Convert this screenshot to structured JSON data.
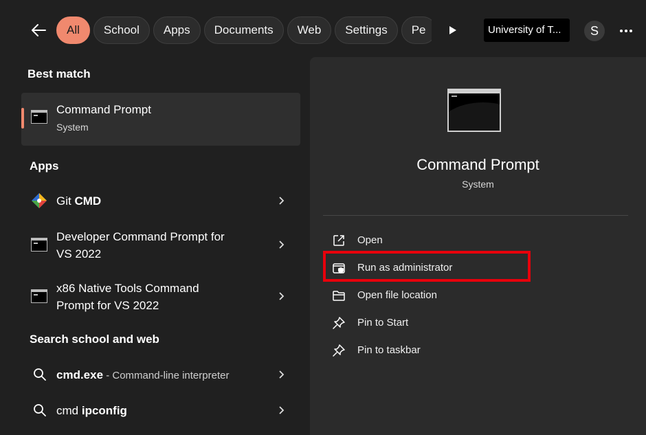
{
  "header": {
    "chips": [
      {
        "label": "All",
        "active": true
      },
      {
        "label": "School"
      },
      {
        "label": "Apps"
      },
      {
        "label": "Documents"
      },
      {
        "label": "Web"
      },
      {
        "label": "Settings"
      },
      {
        "label": "Pe"
      }
    ],
    "org_badge": "University of T...",
    "avatar_initial": "S"
  },
  "left": {
    "best_match_heading": "Best match",
    "best_match": {
      "title": "Command Prompt",
      "subtitle": "System"
    },
    "apps_heading": "Apps",
    "apps": [
      {
        "label": "Git ",
        "label_bold": "CMD",
        "icon": "git-icon"
      },
      {
        "line1": "Developer Command Prompt for",
        "line2": "VS 2022",
        "icon": "command-prompt-icon"
      },
      {
        "line1": "x86 Native Tools Command",
        "line2": "Prompt for VS 2022",
        "icon": "command-prompt-icon"
      }
    ],
    "search_heading": "Search school and web",
    "searches": [
      {
        "bold": "cmd.exe",
        "rest": " - Command-line interpreter",
        "icon": "search-icon"
      },
      {
        "plain": "cmd ",
        "bold": "ipconfig",
        "icon": "search-icon"
      }
    ]
  },
  "detail": {
    "title": "Command Prompt",
    "subtitle": "System",
    "actions": [
      {
        "label": "Open",
        "icon": "open-external-icon"
      },
      {
        "label": "Run as administrator",
        "icon": "shield-icon"
      },
      {
        "label": "Open file location",
        "icon": "folder-icon"
      },
      {
        "label": "Pin to Start",
        "icon": "pin-icon"
      },
      {
        "label": "Pin to taskbar",
        "icon": "pin-icon"
      }
    ]
  },
  "colors": {
    "accent": "#f0896e",
    "highlight_box": "#e8000b",
    "background": "#202020",
    "panel": "#2b2b2b"
  }
}
